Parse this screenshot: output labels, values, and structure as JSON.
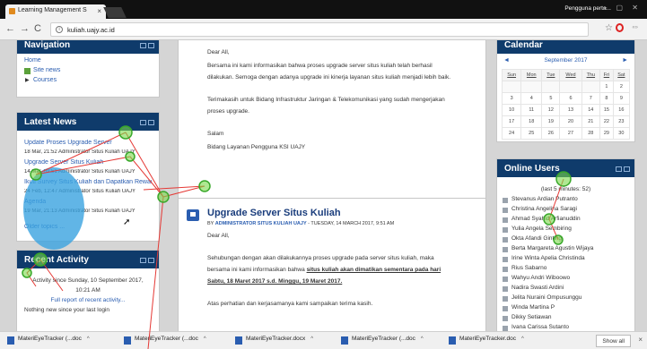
{
  "browser": {
    "tab_title": "Learning Management S",
    "tab_close": "×",
    "profile": "Pengguna perta...",
    "url": "kuliah.uajy.ac.id",
    "nav_back": "←",
    "nav_forward": "→",
    "nav_reload": "C",
    "info": "i",
    "star": "☆",
    "ext": "«»"
  },
  "navigation": {
    "title": "Navigation",
    "home": "Home",
    "site_news": "Site news",
    "courses": "Courses"
  },
  "latest_news": {
    "title": "Latest News",
    "items": [
      {
        "title": "Update Proses Upgrade Server",
        "meta": "18 Mar, 21:52 Administrator Situs Kuliah UAJY"
      },
      {
        "title": "Upgrade Server Situs Kuliah",
        "meta": "14 Mar, 09:51 Administrator Situs Kuliah UAJY"
      },
      {
        "title": "Ikuti Survey Situs Kuliah dan Dapatkan Rewards",
        "meta": "24 Feb, 12:47 Administrator Situs Kuliah UAJY"
      },
      {
        "title": "Agenda",
        "meta": "19 Mar, 21:13 Administrator Situs Kuliah UAJY"
      }
    ],
    "older": "Older topics ..."
  },
  "recent_activity": {
    "title": "Recent Activity",
    "since": "Activity since Sunday, 10 September 2017,",
    "time": "10:21 AM",
    "report": "Full report of recent activity...",
    "nothing": "Nothing new since your last login"
  },
  "post1": {
    "greeting": "Dear All,",
    "p1a": "Bersama ini kami informasikan bahwa proses upgrade server situs kuliah telah berhasil",
    "p1b": "dilakukan. Semoga dengan adanya upgrade ini kinerja layanan situs kuliah menjadi lebih baik.",
    "p2a": "Terimakasih untuk Bidang Infrastruktur Jaringan & Telekomunikasi yang sudah mengerjakan",
    "p2b": "proses upgrade.",
    "salam": "Salam",
    "sign": "Bidang Layanan Pengguna KSI UAJY"
  },
  "post2": {
    "title": "Upgrade Server Situs Kuliah",
    "by": "BY",
    "author": "ADMINISTRATOR SITUS KULIAH UAJY",
    "date": " - TUESDAY, 14 MARCH 2017, 9:51 AM",
    "greeting": "Dear All,",
    "p1a": "Sehubungan dengan akan dilakukannya proses upgrade pada server situs kuliah, maka",
    "p1b_plain": "bersama ini kami informasikan bahwa ",
    "p1b_bold": "situs kuliah akan dimatikan sementara pada hari",
    "p1c_bold": "Sabtu, 18 Maret 2017 s.d. Minggu, 19 Maret 2017.",
    "p2": "Atas perhatian dan kerjasamanya kami sampaikan terima kasih."
  },
  "calendar": {
    "title": "Calendar",
    "month": "September 2017",
    "prev": "◄",
    "next": "►",
    "weekdays": [
      "Sun",
      "Mon",
      "Tue",
      "Wed",
      "Thu",
      "Fri",
      "Sat"
    ],
    "weeks": [
      [
        "",
        "",
        "",
        "",
        "",
        "1",
        "2"
      ],
      [
        "3",
        "4",
        "5",
        "6",
        "7",
        "8",
        "9"
      ],
      [
        "10",
        "11",
        "12",
        "13",
        "14",
        "15",
        "16"
      ],
      [
        "17",
        "18",
        "19",
        "20",
        "21",
        "22",
        "23"
      ],
      [
        "24",
        "25",
        "26",
        "27",
        "28",
        "29",
        "30"
      ]
    ]
  },
  "online_users": {
    "title": "Online Users",
    "subtitle": "(last 5 minutes: 52)",
    "users": [
      "Stevanus Ardian Putranto",
      "Christina Angelina Saragi",
      "Ahmad Syahid Arfianuddin",
      "Yulia Angela Sembiring",
      "Okta Afandi Ginting",
      "Berta Margareta Agustin Wijaya",
      "Irine Winta Apelia Christinda",
      "Rius Sabarno",
      "Wahyu Andri Wiboowo",
      "Nadira Swasti Ardini",
      "Jelita Nuraini Ompusunggu",
      "Winda Martina P",
      "Dikky Setiawan",
      "Ivana Carissa Sutanto"
    ]
  },
  "downloads": {
    "items": [
      "MateriEyeTracker (...doc",
      "MateriEyeTracker (...doc",
      "MateriEyeTracker.docx",
      "MateriEyeTracker (...doc",
      "MateriEyeTracker.doc"
    ],
    "caret": "^",
    "show_all": "Show all",
    "close": "×"
  }
}
